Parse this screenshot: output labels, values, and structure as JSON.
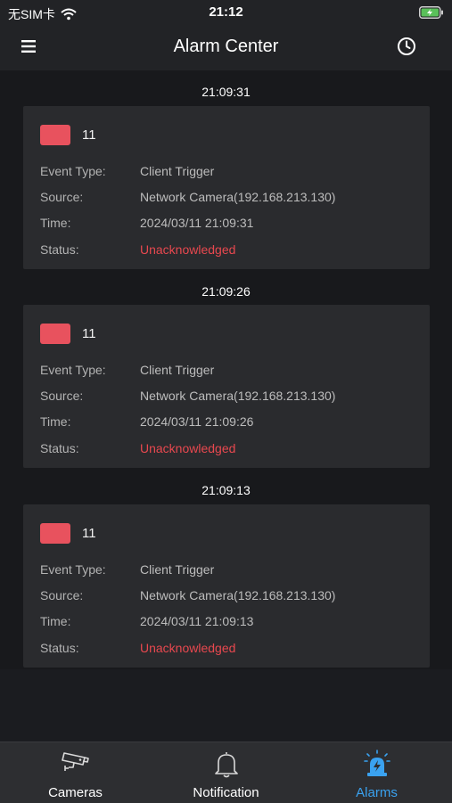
{
  "status_bar": {
    "carrier": "无SIM卡",
    "time": "21:12"
  },
  "header": {
    "title": "Alarm Center"
  },
  "alarms": [
    {
      "group_time": "21:09:31",
      "camera_number": "11",
      "badge_color": "#e8525e",
      "event_type_label": "Event Type:",
      "event_type": "Client Trigger",
      "source_label": "Source:",
      "source": "Network Camera(192.168.213.130)",
      "time_label": "Time:",
      "time": "2024/03/11 21:09:31",
      "status_label": "Status:",
      "status": "Unacknowledged"
    },
    {
      "group_time": "21:09:26",
      "camera_number": "11",
      "badge_color": "#e8525e",
      "event_type_label": "Event Type:",
      "event_type": "Client Trigger",
      "source_label": "Source:",
      "source": "Network Camera(192.168.213.130)",
      "time_label": "Time:",
      "time": "2024/03/11 21:09:26",
      "status_label": "Status:",
      "status": "Unacknowledged"
    },
    {
      "group_time": "21:09:13",
      "camera_number": "11",
      "badge_color": "#e8525e",
      "event_type_label": "Event Type:",
      "event_type": "Client Trigger",
      "source_label": "Source:",
      "source": "Network Camera(192.168.213.130)",
      "time_label": "Time:",
      "time": "2024/03/11 21:09:13",
      "status_label": "Status:",
      "status": "Unacknowledged"
    }
  ],
  "tabs": [
    {
      "label": "Cameras",
      "icon": "cctv-camera-icon",
      "active": false
    },
    {
      "label": "Notification",
      "icon": "bell-icon",
      "active": false
    },
    {
      "label": "Alarms",
      "icon": "alarm-siren-icon",
      "active": true
    }
  ],
  "colors": {
    "accent": "#3aa2f0",
    "unacknowledged": "#e8484f",
    "battery": "#5ac05a"
  }
}
